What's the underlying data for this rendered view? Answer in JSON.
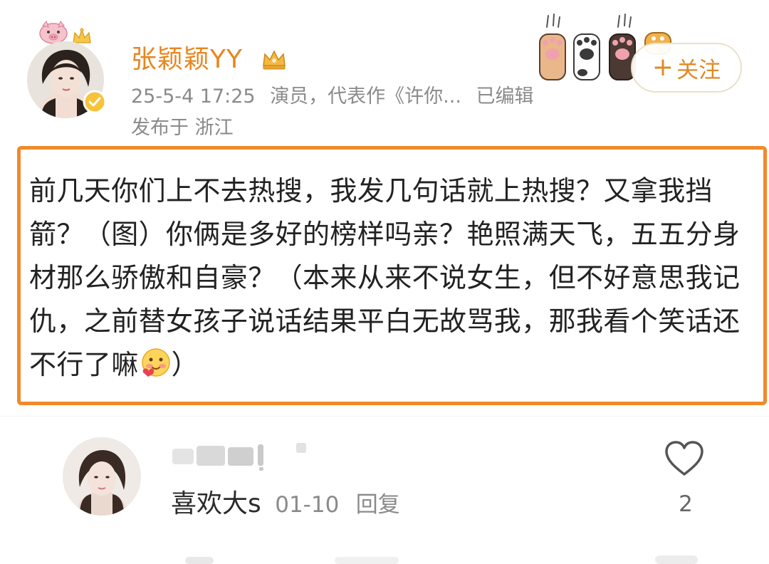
{
  "header": {
    "username": "张颖颖YY",
    "timestamp": "25-5-4 17:25",
    "profession": "演员，代表作《许你...",
    "edited_label": "已编辑",
    "location": "发布于 浙江",
    "follow_label": "关注",
    "follow_plus": "+"
  },
  "post": {
    "text": "前几天你们上不去热搜，我发几句话就上热搜？又拿我挡箭？（图）你俩是多好的榜样吗亲？艳照满天飞，五五分身材那么骄傲和自豪？（本来从来不说女生，但不好意思我记仇，之前替女孩子说话结果平白无故骂我，那我看个笑话还不行了嘛",
    "closing": "）",
    "emoji_icon": "blushing-face-icon"
  },
  "comment": {
    "username_blurred": true,
    "text": "喜欢大s",
    "date": "01-10",
    "reply_label": "回复",
    "like_count": "2"
  },
  "colors": {
    "accent": "#e8861f",
    "highlight_border": "#f08a2a",
    "meta_gray": "#8a8a8a"
  }
}
